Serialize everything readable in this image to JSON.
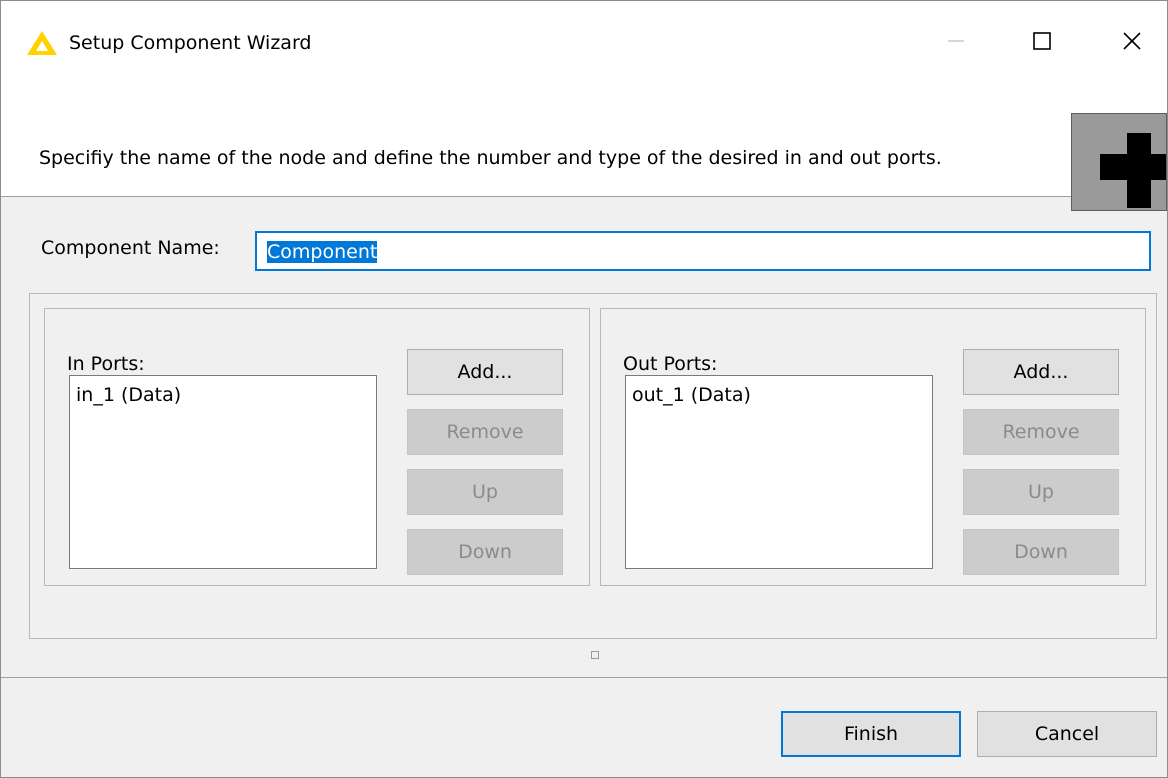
{
  "window": {
    "title": "Setup Component Wizard",
    "minimize_glyph": "—",
    "maximize_glyph": "☐",
    "close_glyph": "✕"
  },
  "header": {
    "description": "Specifiy the name of the node and define the number and type of the desired in and out ports.",
    "image_icon": "component-plus-icon"
  },
  "form": {
    "name_label": "Component Name:",
    "name_value": "Component"
  },
  "in_ports": {
    "label": "In Ports:",
    "items": [
      "in_1 (Data)"
    ],
    "buttons": {
      "add": "Add...",
      "remove": "Remove",
      "up": "Up",
      "down": "Down"
    }
  },
  "out_ports": {
    "label": "Out Ports:",
    "items": [
      "out_1 (Data)"
    ],
    "buttons": {
      "add": "Add...",
      "remove": "Remove",
      "up": "Up",
      "down": "Down"
    }
  },
  "footer": {
    "finish_label": "Finish",
    "cancel_label": "Cancel"
  },
  "colors": {
    "accent": "#0078d7",
    "logo_yellow": "#ffd200",
    "disabled_text": "#8b8b8b"
  }
}
